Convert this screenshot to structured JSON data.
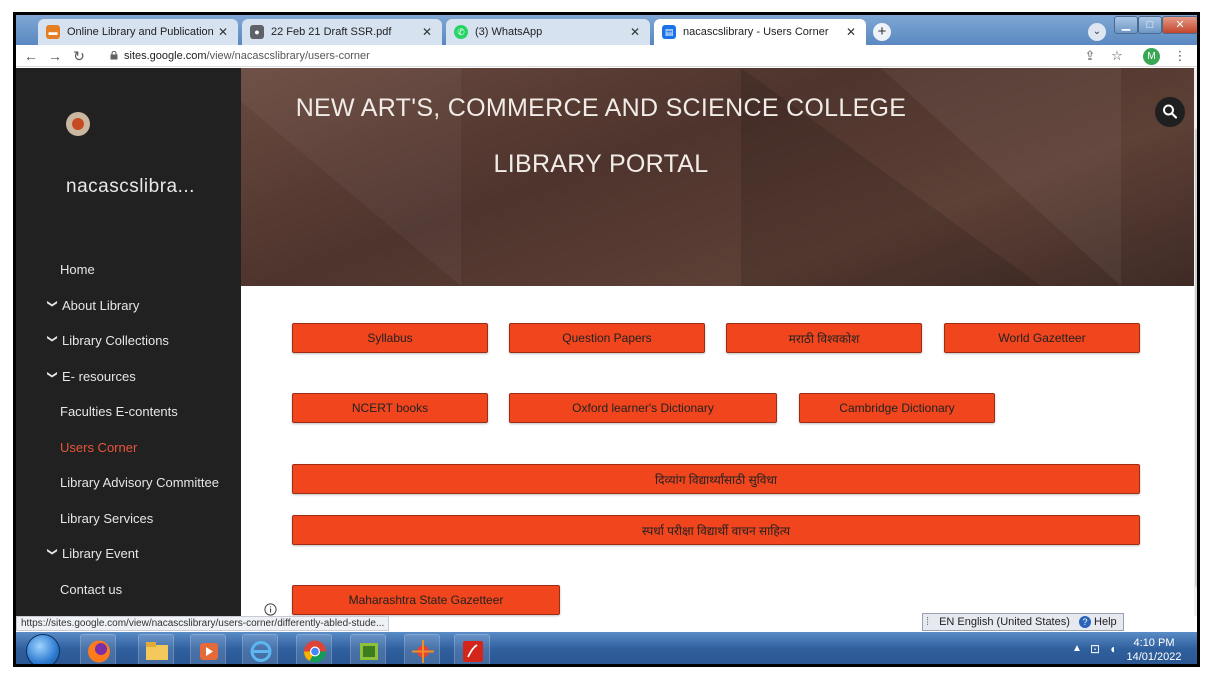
{
  "browser": {
    "tabs": [
      {
        "title": "Online Library and Publication Pl",
        "favicon_color": "#e67e22"
      },
      {
        "title": "22 Feb 21 Draft SSR.pdf",
        "favicon_color": "#5f6368"
      },
      {
        "title": "(3) WhatsApp",
        "favicon_color": "#25d366"
      },
      {
        "title": "nacascslibrary - Users Corner",
        "favicon_color": "#1a73e8"
      }
    ],
    "url_host": "sites.google.com",
    "url_path": "/view/nacascslibrary/users-corner",
    "avatar_letter": "M",
    "status_url": "https://sites.google.com/view/nacascslibrary/users-corner/differently-abled-stude..."
  },
  "sidebar": {
    "site_name": "nacascslibra...",
    "items": [
      {
        "label": "Home",
        "chevron": false
      },
      {
        "label": "About Library",
        "chevron": true
      },
      {
        "label": "Library Collections",
        "chevron": true
      },
      {
        "label": "E- resources",
        "chevron": true
      },
      {
        "label": "Faculties E-contents",
        "chevron": false
      },
      {
        "label": "Users Corner",
        "chevron": false,
        "active": true
      },
      {
        "label": "Library Advisory Committee",
        "chevron": false
      },
      {
        "label": "Library Services",
        "chevron": false
      },
      {
        "label": "Library Event",
        "chevron": true
      },
      {
        "label": "Contact us",
        "chevron": false
      }
    ]
  },
  "banner": {
    "title": "NEW ART'S, COMMERCE AND SCIENCE COLLEGE",
    "subtitle": "LIBRARY PORTAL"
  },
  "buttons": {
    "syllabus": "Syllabus",
    "question_papers": "Question Papers",
    "marathi_vishwakosh": "मराठी विश्वकोश",
    "world_gazetteer": "World Gazetteer",
    "ncert_books": "NCERT books",
    "oxford_dictionary": "Oxford learner's Dictionary",
    "cambridge_dictionary": "Cambridge Dictionary",
    "divyang": "दिव्यांग विद्यार्थ्यांसाठी सुविधा",
    "spardha": "स्पर्धा परीक्षा विद्यार्थी वाचन साहित्य",
    "maharashtra_gazetteer": "Maharashtra State Gazetteer"
  },
  "language_bar": {
    "language": "EN English (United States)",
    "help": "Help"
  },
  "clock": {
    "time": "4:10 PM",
    "date": "14/01/2022"
  },
  "colors": {
    "accent": "#f0451d",
    "sidebar_bg": "#212121",
    "active_nav": "#e8553a"
  }
}
